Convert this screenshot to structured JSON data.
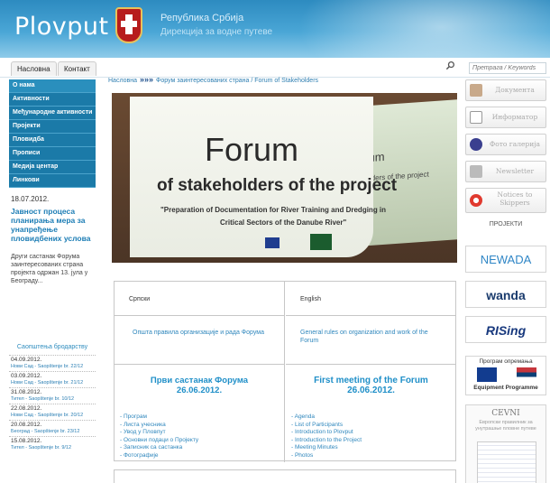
{
  "header": {
    "logo": "Plovput",
    "line1": "Република Србија",
    "line2": "Дирекција за водне путеве"
  },
  "topbar": {
    "tabs": [
      "Насловна",
      "Контакт"
    ],
    "search_placeholder": "Претрага / Keywords"
  },
  "leftnav": {
    "items": [
      "О нама",
      "Активности",
      "Међународне активности",
      "Пројекти",
      "Пловидба",
      "Прописи",
      "Медија центар",
      "Линкови"
    ]
  },
  "news": {
    "date": "18.07.2012.",
    "title": "Јавност процеса планирања мера за унапређење пловидбених услова",
    "body": "Други састанак Форума заинтересованих страна пројекта одржан 13. јула у Београду..."
  },
  "notices": {
    "title": "Саопштења бродарству",
    "entries": [
      {
        "date": "04.09.2012.",
        "link": "Нови Сад - Saopštenje br. 22/12"
      },
      {
        "date": "03.09.2012.",
        "link": "Нови Сад - Saopštenje br. 21/12"
      },
      {
        "date": "31.08.2012.",
        "link": "Тител - Saopštenje br. 10/12"
      },
      {
        "date": "22.08.2012.",
        "link": "Нови Сад - Saopštenje br. 20/12"
      },
      {
        "date": "20.08.2012.",
        "link": "Београд - Saopštenje br. 23/12"
      },
      {
        "date": "15.08.2012.",
        "link": "Тител - Saopštenje br. 9/12"
      }
    ]
  },
  "breadcrumb": {
    "home": "Насловна",
    "arrows": "»»»",
    "path": "Форум заинтересованих страна / Forum of Stakeholders"
  },
  "hero": {
    "forum": "Forum",
    "stakeholders": "of stakeholders of the project",
    "prep_line1": "\"Preparation of Documentation for River Training and Dredging in",
    "prep_line2": "Critical Sectors of the Danube River\"",
    "screen2_title": "Forum",
    "screen2_sub": "of stakeholders of the project"
  },
  "doc_table": {
    "left": {
      "header": "Српски",
      "rules": "Општа правила организације и рада Форума",
      "meeting_line1": "Први састанак Форума",
      "meeting_line2": "26.06.2012.",
      "docs": [
        "- Програм",
        "- Листа учесника",
        "- Увод у Пловпут",
        "- Основни подаци о Пројекту",
        "- Записник са састанка",
        "- Фотографије"
      ]
    },
    "right": {
      "header": "English",
      "rules": "General rules on organization and work of the Forum",
      "meeting_line1": "First meeting of the Forum",
      "meeting_line2": "26.06.2012.",
      "docs": [
        "- Agenda",
        "- List of Participants",
        "- Introduction to Plovput",
        "- Introduction to the Project",
        "- Meeting Minutes",
        "- Photos"
      ]
    }
  },
  "rightbar": {
    "buttons": [
      "Документа",
      "Информатор",
      "Фото галерија",
      "Newsletter",
      "Notices to Skippers"
    ],
    "projects_title": "ПРОЈЕКТИ",
    "partners": [
      "NEWADA",
      "wanda",
      "RISing"
    ],
    "equipment_top": "Програм опремања",
    "equipment_bottom": "Equipment Programme",
    "cevni_title": "CEVNI",
    "cevni_sub": "Европски правилник за унутрашње пловне путеве"
  },
  "colors": {
    "header": "#2d8bc0",
    "nav": "#1b7aa8",
    "link": "#2f87bd",
    "meeting": "#1f8fc8"
  }
}
